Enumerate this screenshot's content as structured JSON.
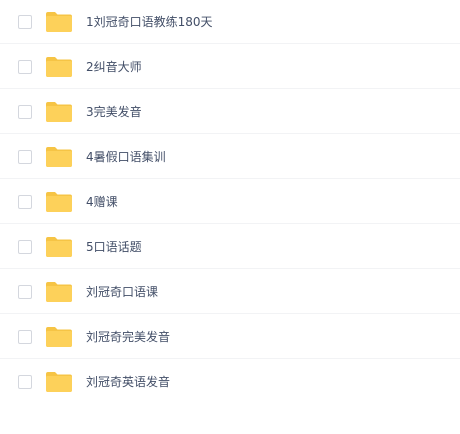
{
  "file_list": {
    "items": [
      {
        "name": "1刘冠奇口语教练180天",
        "type": "folder"
      },
      {
        "name": "2纠音大师",
        "type": "folder"
      },
      {
        "name": "3完美发音",
        "type": "folder"
      },
      {
        "name": "4暑假口语集训",
        "type": "folder"
      },
      {
        "name": "4赠课",
        "type": "folder"
      },
      {
        "name": "5口语话题",
        "type": "folder"
      },
      {
        "name": "刘冠奇口语课",
        "type": "folder"
      },
      {
        "name": "刘冠奇完美发音",
        "type": "folder"
      },
      {
        "name": "刘冠奇英语发音",
        "type": "folder"
      }
    ]
  },
  "colors": {
    "folder_body": "#fdd15a",
    "folder_tab": "#f6c445",
    "text": "#424e67",
    "divider": "#f2f3f5",
    "checkbox_border": "#d4d7de"
  },
  "icons": {
    "folder": "folder-icon",
    "checkbox": "checkbox-icon"
  }
}
